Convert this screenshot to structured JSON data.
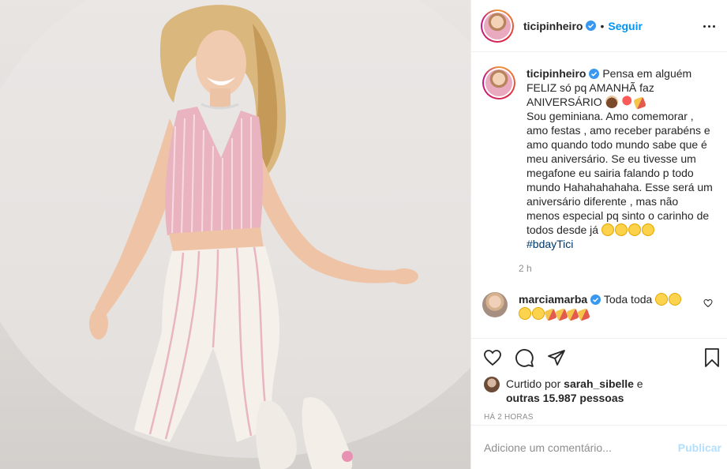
{
  "post": {
    "image_alt": "photo"
  },
  "header": {
    "username": "ticipinheiro",
    "separator": "•",
    "follow_label": "Seguir"
  },
  "caption": {
    "username": "ticipinheiro",
    "line1": "Pensa em alguém FELIZ só pq AMANHÃ faz ANIVERSÁRIO",
    "paragraph": "Sou geminiana. Amo comemorar , amo festas , amo receber parabéns e amo quando todo mundo sabe que é meu aniversário. Se eu tivesse um megafone eu sairia falando p todo mundo Hahahahahaha. Esse será um aniversário diferente , mas não menos especial pq sinto o carinho de todos desde já",
    "hashtag": "#bdayTici",
    "time": "2 h"
  },
  "comments": [
    {
      "username": "marciamarba",
      "text": "Toda toda"
    }
  ],
  "likes": {
    "prefix": "Curtido por",
    "first_user": "sarah_sibelle",
    "joiner": "e",
    "others": "outras 15.987 pessoas"
  },
  "posted_time": "HÁ 2 HORAS",
  "add_comment": {
    "placeholder": "Adicione um comentário...",
    "publish_label": "Publicar"
  },
  "icons": [
    "verified-icon",
    "more-icon",
    "heart-icon",
    "comment-icon",
    "share-icon",
    "bookmark-icon"
  ],
  "colors": {
    "link": "#0095f6",
    "verified": "#3897f0",
    "muted": "#8e8e8e",
    "border": "#efefef"
  }
}
